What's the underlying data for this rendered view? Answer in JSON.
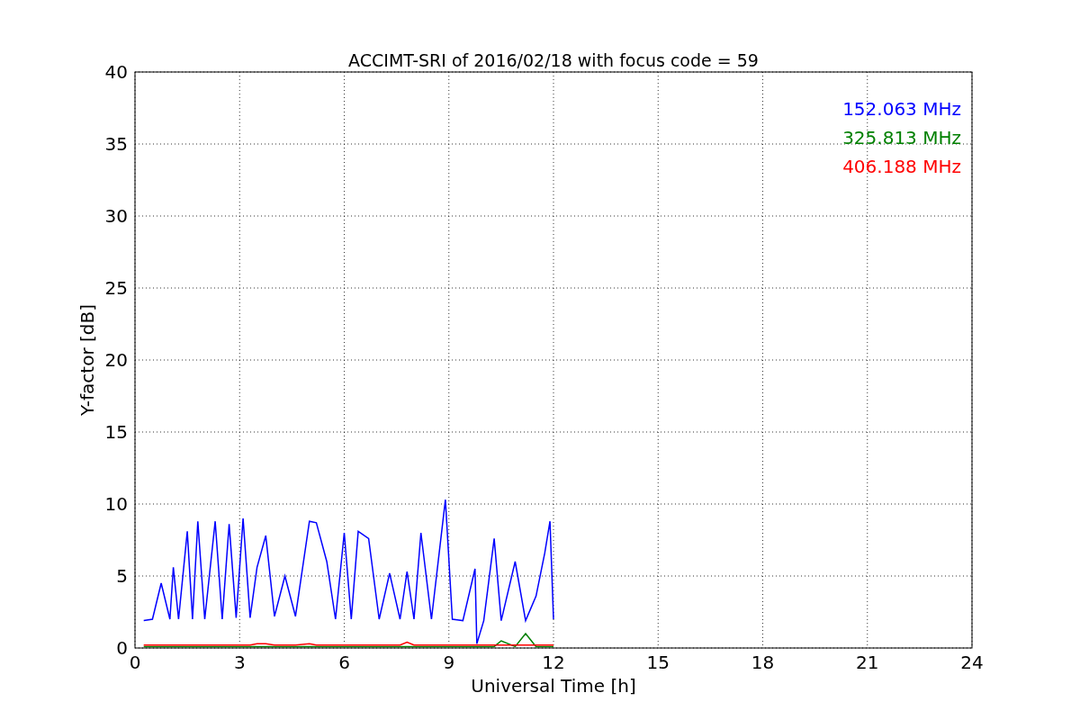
{
  "chart_data": {
    "type": "line",
    "title": "ACCIMT-SRI of 2016/02/18 with focus code = 59",
    "xlabel": "Universal Time [h]",
    "ylabel": "Y-factor [dB]",
    "x": [
      0.25,
      0.5,
      0.75,
      1.0,
      1.1,
      1.25,
      1.5,
      1.65,
      1.8,
      2.0,
      2.3,
      2.5,
      2.7,
      2.9,
      3.1,
      3.3,
      3.5,
      3.75,
      4.0,
      4.3,
      4.6,
      5.0,
      5.2,
      5.5,
      5.75,
      6.0,
      6.2,
      6.4,
      6.7,
      7.0,
      7.3,
      7.6,
      7.8,
      8.0,
      8.2,
      8.5,
      8.9,
      9.1,
      9.4,
      9.75,
      9.8,
      10.0,
      10.3,
      10.5,
      10.9,
      11.2,
      11.5,
      11.75,
      11.9,
      12.0
    ],
    "series": [
      {
        "name": "152.063 MHz",
        "color": "#0000ff",
        "values": [
          1.9,
          2.0,
          4.5,
          2.0,
          5.6,
          2.0,
          8.1,
          2.0,
          8.8,
          2.0,
          8.8,
          2.0,
          8.6,
          2.1,
          9.0,
          2.1,
          5.6,
          7.8,
          2.2,
          5.0,
          2.2,
          8.8,
          8.7,
          6.0,
          2.0,
          8.0,
          2.0,
          8.1,
          7.6,
          2.0,
          5.2,
          2.0,
          5.3,
          2.0,
          8.0,
          2.0,
          10.3,
          2.0,
          1.9,
          5.5,
          0.3,
          1.9,
          7.6,
          1.9,
          6.0,
          1.9,
          3.6,
          6.6,
          8.8,
          2.0
        ]
      },
      {
        "name": "325.813 MHz",
        "color": "#008000",
        "values": [
          0.1,
          0.1,
          0.1,
          0.1,
          0.1,
          0.1,
          0.1,
          0.1,
          0.1,
          0.1,
          0.1,
          0.1,
          0.1,
          0.1,
          0.1,
          0.1,
          0.1,
          0.1,
          0.1,
          0.1,
          0.1,
          0.1,
          0.1,
          0.1,
          0.1,
          0.1,
          0.1,
          0.1,
          0.1,
          0.1,
          0.1,
          0.1,
          0.1,
          0.1,
          0.1,
          0.1,
          0.1,
          0.1,
          0.1,
          0.1,
          0.1,
          0.1,
          0.1,
          0.5,
          0.1,
          1.0,
          0.1,
          0.1,
          0.1,
          0.1
        ]
      },
      {
        "name": "406.188 MHz",
        "color": "#ff0000",
        "values": [
          0.2,
          0.2,
          0.2,
          0.2,
          0.2,
          0.2,
          0.2,
          0.2,
          0.2,
          0.2,
          0.2,
          0.2,
          0.2,
          0.2,
          0.2,
          0.2,
          0.3,
          0.3,
          0.2,
          0.2,
          0.2,
          0.3,
          0.2,
          0.2,
          0.2,
          0.2,
          0.2,
          0.2,
          0.2,
          0.2,
          0.2,
          0.2,
          0.4,
          0.2,
          0.2,
          0.2,
          0.2,
          0.2,
          0.2,
          0.2,
          0.2,
          0.2,
          0.2,
          0.2,
          0.2,
          0.2,
          0.2,
          0.2,
          0.2,
          0.2
        ]
      }
    ],
    "grid": true,
    "xlim": [
      0,
      24
    ],
    "ylim": [
      0,
      40
    ],
    "xticks": [
      0,
      3,
      6,
      9,
      12,
      15,
      18,
      21,
      24
    ],
    "yticks": [
      0,
      5,
      10,
      15,
      20,
      25,
      30,
      35,
      40
    ]
  }
}
